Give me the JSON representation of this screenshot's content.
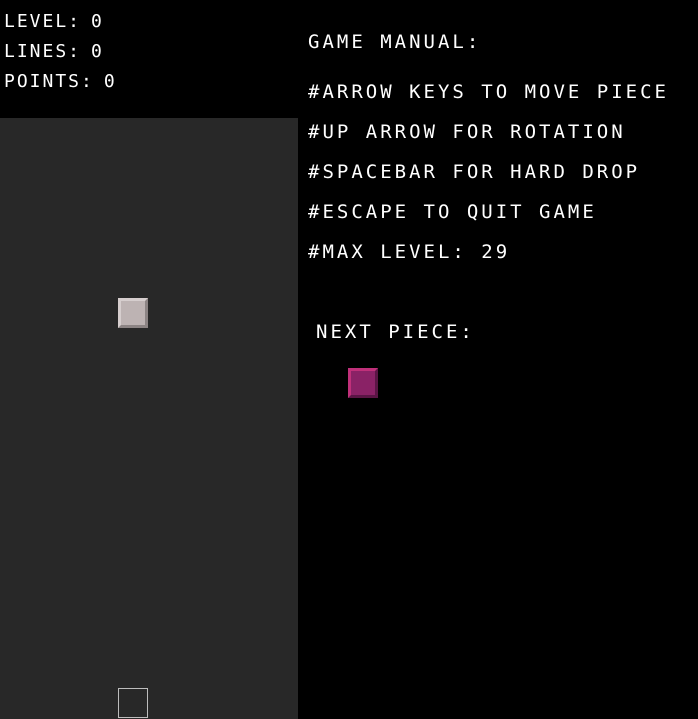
{
  "stats": {
    "level_label": "LEVEL:",
    "level_value": "0",
    "lines_label": "LINES:",
    "lines_value": "0",
    "points_label": "POINTS:",
    "points_value": "0"
  },
  "manual": {
    "title": "GAME MANUAL:",
    "lines": [
      "#ARROW KEYS TO MOVE PIECE",
      "#UP ARROW FOR ROTATION",
      "#SPACEBAR FOR HARD DROP",
      "#ESCAPE TO QUIT GAME",
      "#MAX LEVEL: 29"
    ]
  },
  "next_piece": {
    "label": "NEXT PIECE:",
    "color": "#8a2266"
  },
  "board": {
    "background": "#282828",
    "active_piece_color": "#bdb3b3"
  }
}
